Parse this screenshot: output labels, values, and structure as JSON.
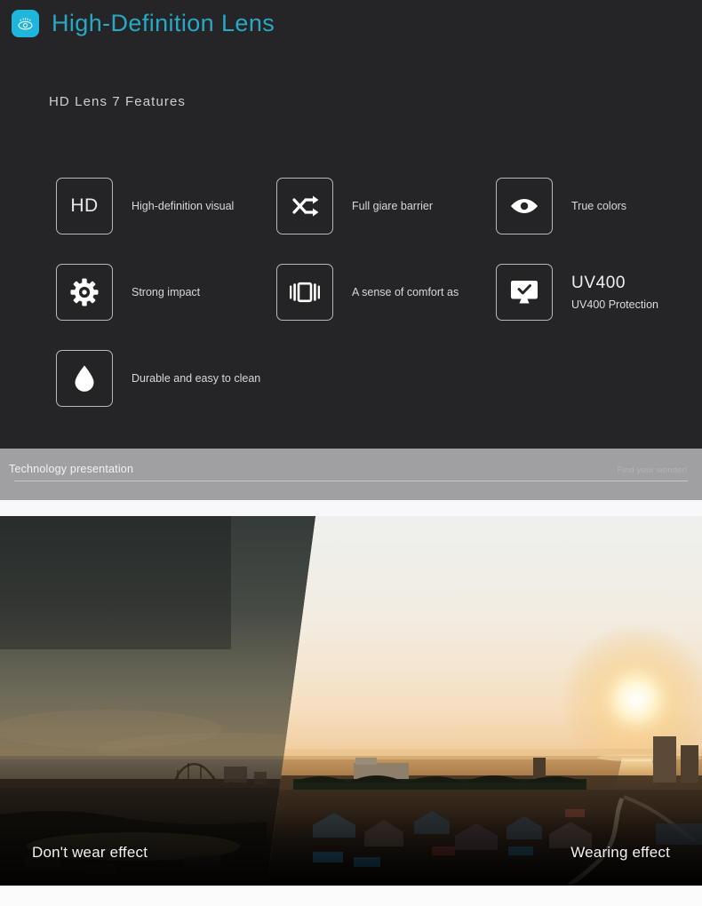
{
  "header": {
    "title": "High-Definition Lens",
    "icon": "eye-icon",
    "icon_bg": "#1fb6dd",
    "title_color": "#27a8c4"
  },
  "section": {
    "subtitle": "HD Lens 7 Features"
  },
  "features": [
    {
      "icon": "hd-text-icon",
      "glyph": "HD",
      "label": "High-definition visual"
    },
    {
      "icon": "shuffle-arrows-icon",
      "glyph": "",
      "label": "Full giare barrier"
    },
    {
      "icon": "eye-icon",
      "glyph": "",
      "label": "True colors"
    },
    {
      "icon": "gear-icon",
      "glyph": "",
      "label": "Strong impact"
    },
    {
      "icon": "film-frame-icon",
      "glyph": "",
      "label": "A sense of comfort as"
    },
    {
      "icon": "monitor-check-icon",
      "glyph": "",
      "label": "UV400",
      "sublabel": "UV400 Protection"
    },
    {
      "icon": "water-drop-icon",
      "glyph": "",
      "label": "Durable and easy to clean"
    }
  ],
  "banner": {
    "left_text": "Technology presentation",
    "right_text": "Find your wonder!",
    "bg_color": "#a0a0a2"
  },
  "photo": {
    "caption_left": "Don't wear effect",
    "caption_right": "Wearing effect"
  }
}
